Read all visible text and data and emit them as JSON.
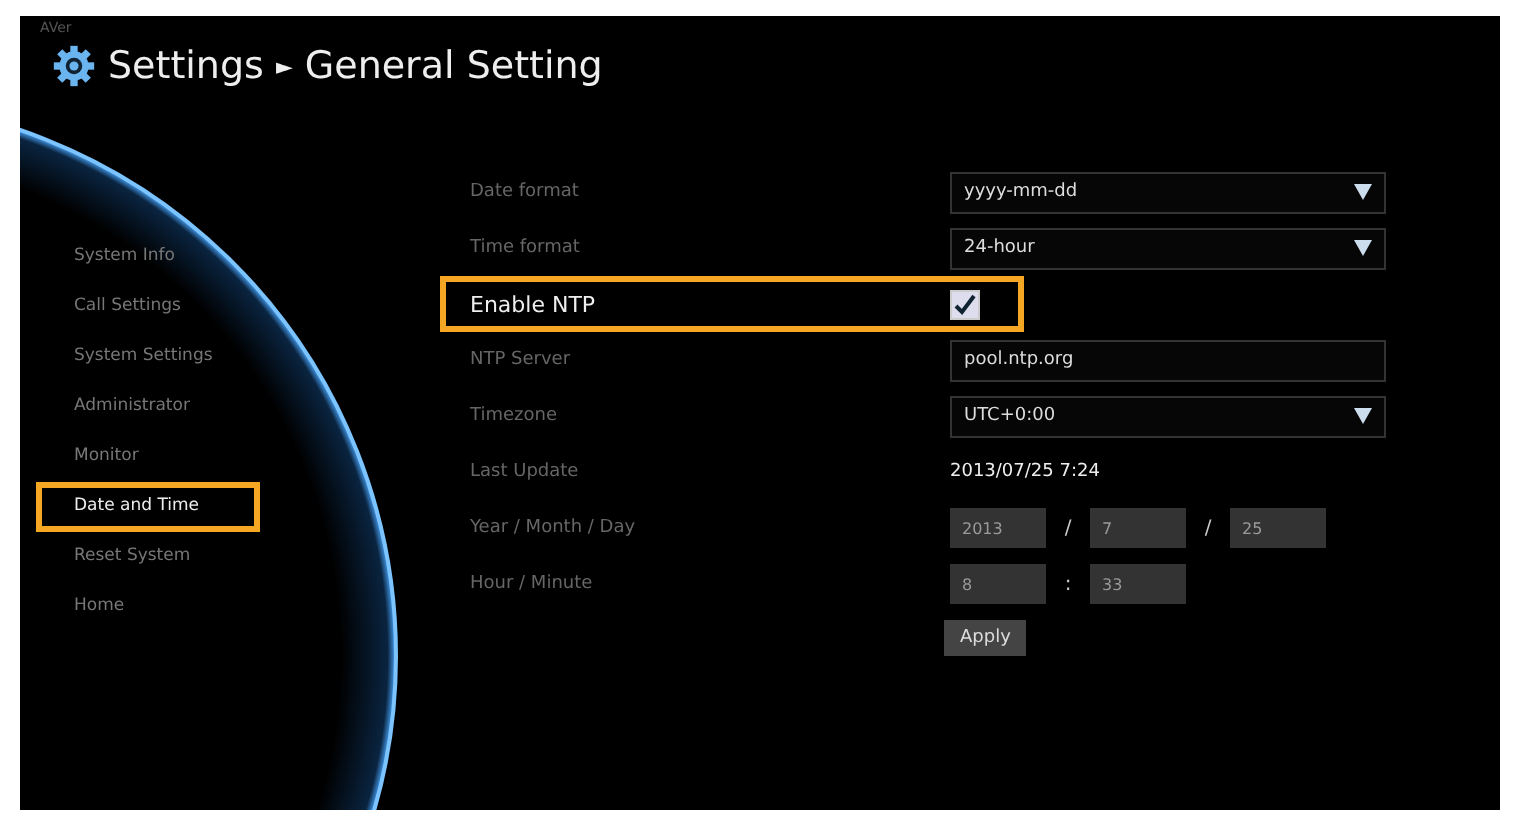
{
  "logo": "AVer",
  "header": {
    "title": "Settings",
    "separator": "►",
    "subtitle": "General Setting"
  },
  "sidebar": {
    "items": [
      {
        "label": "System Info",
        "selected": false,
        "highlighted": false
      },
      {
        "label": "Call Settings",
        "selected": false,
        "highlighted": false
      },
      {
        "label": "System Settings",
        "selected": false,
        "highlighted": false
      },
      {
        "label": "Administrator",
        "selected": false,
        "highlighted": false
      },
      {
        "label": "Monitor",
        "selected": false,
        "highlighted": false
      },
      {
        "label": "Date and Time",
        "selected": true,
        "highlighted": true
      },
      {
        "label": "Reset System",
        "selected": false,
        "highlighted": false
      },
      {
        "label": "Home",
        "selected": false,
        "highlighted": false
      }
    ]
  },
  "rows": [
    {
      "kind": "select",
      "label": "Date format",
      "value": "yyyy-mm-dd",
      "highlighted": false
    },
    {
      "kind": "select",
      "label": "Time format",
      "value": "24-hour",
      "highlighted": false
    },
    {
      "kind": "checkbox",
      "label": "Enable NTP",
      "checked": true,
      "highlighted": true
    },
    {
      "kind": "text",
      "label": "NTP Server",
      "value": "pool.ntp.org",
      "highlighted": false
    },
    {
      "kind": "select",
      "label": "Timezone",
      "value": "UTC+0:00",
      "highlighted": false
    },
    {
      "kind": "value",
      "label": "Last Update",
      "value": "2013/07/25 7:24",
      "highlighted": false
    },
    {
      "kind": "parts",
      "label": "Year / Month / Day",
      "disabled": true,
      "highlighted": false,
      "parts": [
        {
          "value": "2013",
          "sep": "/"
        },
        {
          "value": "7",
          "sep": "/"
        },
        {
          "value": "25"
        }
      ]
    },
    {
      "kind": "parts",
      "label": "Hour / Minute",
      "disabled": true,
      "highlighted": false,
      "parts": [
        {
          "value": "8",
          "sep": ":"
        },
        {
          "value": "33"
        }
      ]
    }
  ],
  "apply_button": "Apply"
}
